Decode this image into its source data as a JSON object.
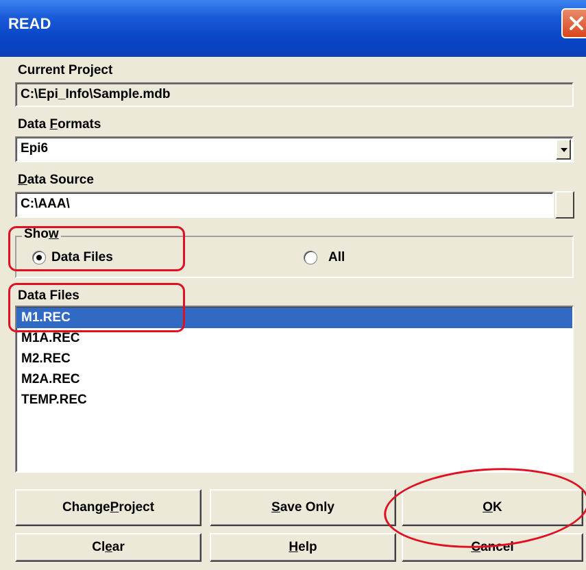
{
  "window": {
    "title": "READ"
  },
  "current_project": {
    "label": "Current Project",
    "value": "C:\\Epi_Info\\Sample.mdb"
  },
  "data_formats": {
    "label_pre": "Data ",
    "label_u": "F",
    "label_post": "ormats",
    "selected": "Epi6"
  },
  "data_source": {
    "label_u": "D",
    "label_post": "ata Source",
    "value": "C:\\AAA\\"
  },
  "show": {
    "legend_pre": "Sho",
    "legend_u": "w",
    "options": [
      {
        "label": "Data Files",
        "checked": true
      },
      {
        "label": "All",
        "checked": false
      }
    ]
  },
  "data_files": {
    "label": "Data Files",
    "items": [
      "M1.REC",
      "M1A.REC",
      "M2.REC",
      "M2A.REC",
      "TEMP.REC"
    ],
    "selected_index": 0
  },
  "buttons": {
    "change_project": {
      "pre": "Change ",
      "u": "P",
      "post": "roject"
    },
    "save_only": {
      "pre": "",
      "u": "S",
      "post": "ave Only"
    },
    "ok": {
      "pre": "",
      "u": "O",
      "post": "K"
    },
    "clear": {
      "pre": "Cl",
      "u": "e",
      "post": "ar"
    },
    "help": {
      "pre": "",
      "u": "H",
      "post": "elp"
    },
    "cancel": {
      "pre": "",
      "u": "C",
      "post": "ancel"
    }
  },
  "icons": {
    "close": "close-icon",
    "dropdown": "chevron-down-icon"
  },
  "colors": {
    "titlebar": "#0a46c8",
    "selection": "#316ac5",
    "annotation": "#e01020"
  }
}
